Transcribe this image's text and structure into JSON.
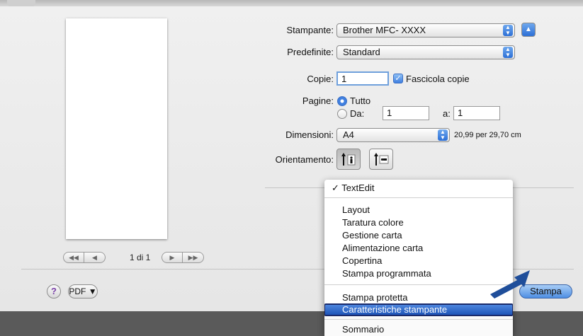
{
  "printer": {
    "label": "Stampante:",
    "value": "Brother MFC- XXXX"
  },
  "presets": {
    "label": "Predefinite:",
    "value": "Standard"
  },
  "copies": {
    "label": "Copie:",
    "value": "1",
    "collate_label": "Fascicola copie",
    "collate_checked": true
  },
  "pages": {
    "label": "Pagine:",
    "all_label": "Tutto",
    "from_label": "Da:",
    "from_value": "1",
    "to_label": "a:",
    "to_value": "1",
    "selected": "all"
  },
  "paper": {
    "label": "Dimensioni:",
    "value": "A4",
    "size_text": "20,99 per 29,70 cm"
  },
  "orientation": {
    "label": "Orientamento:",
    "selected": "portrait"
  },
  "preview": {
    "page_info": "1 di 1"
  },
  "panel_menu": {
    "current": "TextEdit",
    "items": [
      "Layout",
      "Taratura colore",
      "Gestione carta",
      "Alimentazione carta",
      "Copertina",
      "Stampa programmata"
    ],
    "items2": [
      "Stampa protetta",
      "Caratteristiche stampante"
    ],
    "items3": [
      "Sommario"
    ],
    "highlighted": "Caratteristiche stampante"
  },
  "footer": {
    "help": "?",
    "pdf_label": "PDF ▼",
    "print_label": "Stampa"
  },
  "colors": {
    "accent": "#3f7fe0",
    "highlight": "#2a63c4",
    "pointer": "#1f4e9a"
  }
}
